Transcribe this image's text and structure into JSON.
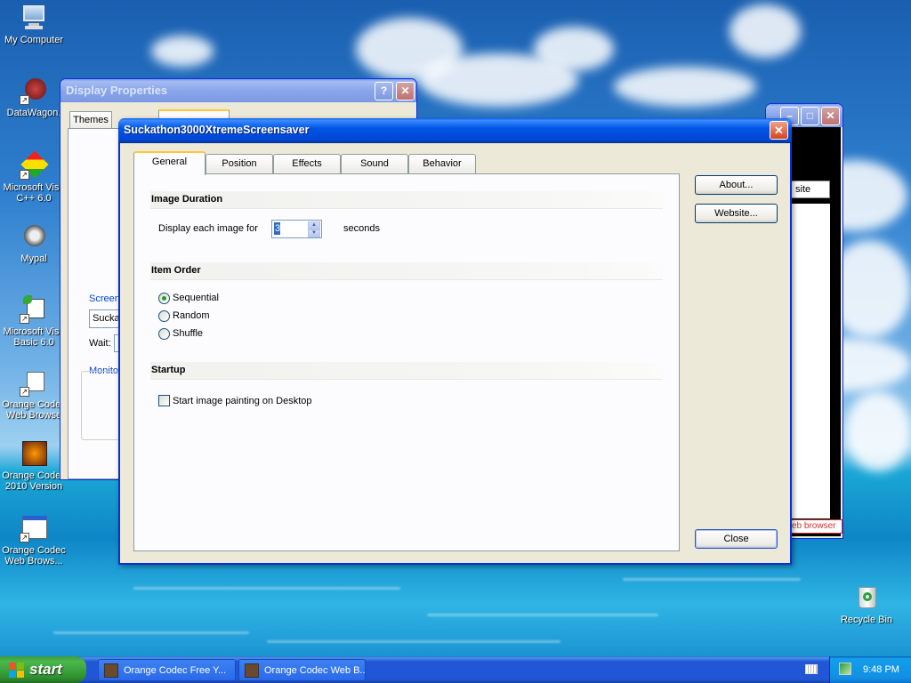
{
  "desktop": {
    "icons": [
      {
        "label": "My Computer",
        "icon": "my-computer-icon"
      },
      {
        "label": "DataWagon.",
        "icon": "datawagon-icon"
      },
      {
        "label": "Microsoft Visu C++ 6.0",
        "icon": "visual-cpp-icon"
      },
      {
        "label": "Mypal",
        "icon": "mypal-icon"
      },
      {
        "label": "Microsoft Visu Basic 6.0",
        "icon": "visual-basic-icon"
      },
      {
        "label": "Orange Codec Web Browse",
        "icon": "orange-codec-browser-icon"
      },
      {
        "label": "Orange Codec 2010 Version",
        "icon": "orange-codec-2010-icon"
      },
      {
        "label": "Orange Codec Web Brows...",
        "icon": "orange-codec-web-icon"
      },
      {
        "label": "Recycle Bin",
        "icon": "recycle-bin-icon"
      }
    ]
  },
  "display_properties": {
    "title": "Display Properties",
    "help": "?",
    "close": "✕",
    "tabs": [
      "Themes"
    ],
    "screen_group": "Screen",
    "screen_value": "Sucka",
    "wait": "Wait:",
    "monitor_group": "Monito"
  },
  "back_window": {
    "minimize": "–",
    "maximize": "□",
    "close": "✕",
    "button": "site",
    "status": "eb browser"
  },
  "dialog": {
    "title": "Suckathon3000XtremeScreensaver",
    "close": "✕",
    "tabs": [
      "General",
      "Position",
      "Effects",
      "Sound",
      "Behavior"
    ],
    "active_tab": "General",
    "sections": {
      "image_duration": "Image Duration",
      "item_order": "Item Order",
      "startup": "Startup"
    },
    "display_each_image_for": "Display each image for",
    "duration_value": "3",
    "seconds": "seconds",
    "order_options": [
      "Sequential",
      "Random",
      "Shuffle"
    ],
    "selected_order": "Sequential",
    "startup_checkbox": "Start image painting on Desktop",
    "startup_checked": false,
    "buttons": {
      "about": "About...",
      "website": "Website...",
      "close": "Close"
    }
  },
  "taskbar": {
    "start": "start",
    "tasks": [
      "Orange Codec Free Y...",
      "Orange Codec Web B..."
    ],
    "time": "9:48 PM"
  }
}
